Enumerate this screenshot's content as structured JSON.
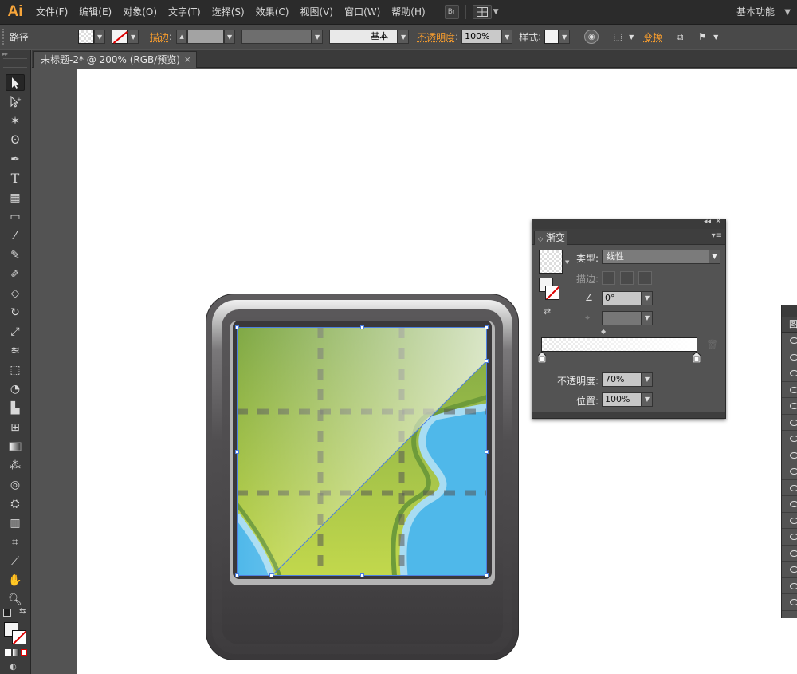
{
  "app": {
    "logo": "Ai",
    "menu": [
      "文件(F)",
      "编辑(E)",
      "对象(O)",
      "文字(T)",
      "选择(S)",
      "效果(C)",
      "视图(V)",
      "窗口(W)",
      "帮助(H)"
    ],
    "bridge_label": "Br",
    "workspace": "基本功能"
  },
  "control_bar": {
    "object_type": "路径",
    "stroke_label": "描边",
    "stroke_style": "基本",
    "opacity_label": "不透明度",
    "opacity_value": "100%",
    "style_label": "样式",
    "transform_label": "变换"
  },
  "document": {
    "tab_title": "未标题-2* @ 200% (RGB/预览)",
    "close": "×"
  },
  "gradient_panel": {
    "title": "渐变",
    "type_label": "类型:",
    "type_value": "线性",
    "stroke_label": "描边:",
    "angle_value": "0°",
    "opacity_label": "不透明度:",
    "opacity_value": "70%",
    "location_label": "位置:",
    "location_value": "100%"
  },
  "layers_panel": {
    "tab_label": "图"
  },
  "colors": {
    "accent_orange": "#f29a2e",
    "selection_blue": "#4d7fe0",
    "map_green": "#8db24a",
    "map_water": "#4fb8ea"
  }
}
